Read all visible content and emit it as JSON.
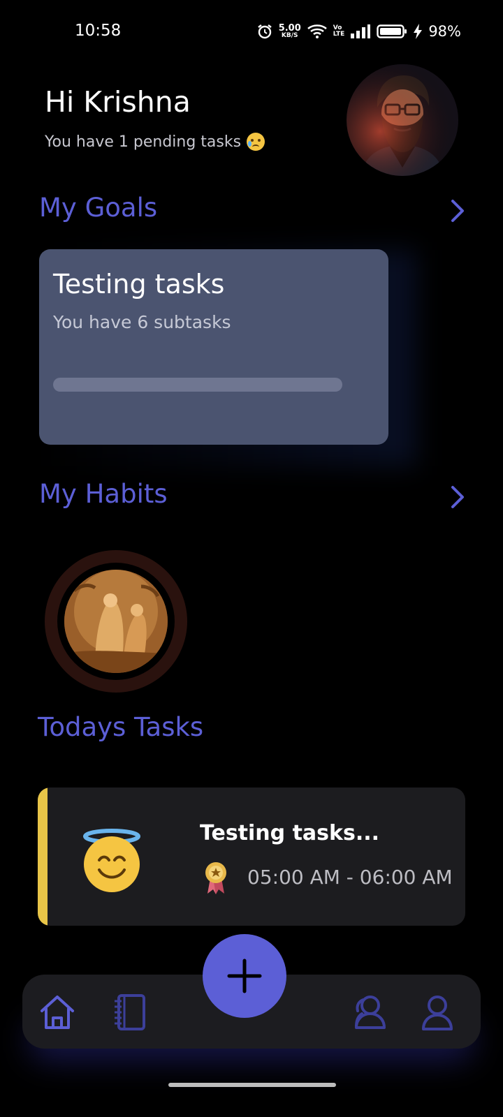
{
  "status_bar": {
    "time": "10:58",
    "net_speed_value": "5.00",
    "net_speed_unit": "KB/S",
    "volte_top": "Vo",
    "volte_bottom": "LTE",
    "battery_percent": "98%"
  },
  "header": {
    "greeting": "Hi Krishna",
    "pending_text": "You have 1 pending tasks"
  },
  "goals": {
    "section_title": "My Goals",
    "cards": [
      {
        "title": "Testing tasks",
        "subtitle": "You have 6 subtasks",
        "progress": 0
      }
    ]
  },
  "habits": {
    "section_title": "My Habits"
  },
  "tasks": {
    "section_title": "Todays Tasks",
    "items": [
      {
        "title": "Testing tasks...",
        "time_range": "05:00 AM - 06:00 AM",
        "accent_color": "#e8c548"
      }
    ]
  },
  "bottom_nav": {
    "items": [
      {
        "icon": "home-icon",
        "active": true
      },
      {
        "icon": "notebook-icon",
        "active": false
      },
      {
        "icon": "add-icon",
        "active": false
      },
      {
        "icon": "group-icon",
        "active": false
      },
      {
        "icon": "profile-icon",
        "active": false
      }
    ]
  },
  "colors": {
    "accent": "#5c5fd6",
    "background": "#000000",
    "card": "#4b5470",
    "task_card": "#1c1c1f"
  }
}
